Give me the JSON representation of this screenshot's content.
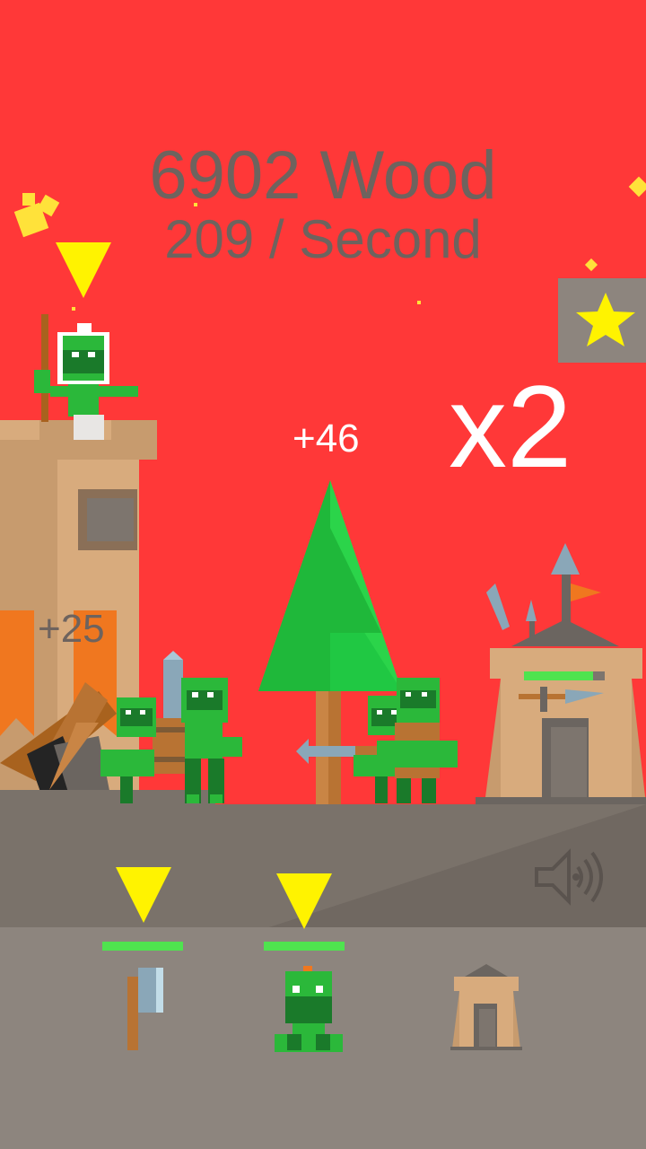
{
  "hud": {
    "resource_line": "6902 Wood",
    "rate_line": "209 / Second",
    "multiplier": "x2"
  },
  "popups": {
    "tree_gain": "+46",
    "tower_gain": "+25"
  },
  "buttons": {
    "favorite_icon": "star-icon",
    "sound_icon": "speaker-icon"
  },
  "toolbar": {
    "slots": [
      {
        "name": "axe-upgrade",
        "icon": "axe-icon",
        "progress": 1.0,
        "highlighted": true
      },
      {
        "name": "orc-upgrade",
        "icon": "orc-icon",
        "progress": 1.0,
        "highlighted": true
      },
      {
        "name": "fort-upgrade",
        "icon": "fort-icon",
        "progress": null,
        "highlighted": false
      }
    ]
  },
  "enemy_fort": {
    "health": 0.85
  },
  "colors": {
    "sky": "#ff3838",
    "ground": "#7a726a",
    "tray": "#8d857e",
    "text": "#6e635e",
    "highlight": "#fff300",
    "bar": "#4fe34f",
    "orc": "#2bb83a"
  }
}
